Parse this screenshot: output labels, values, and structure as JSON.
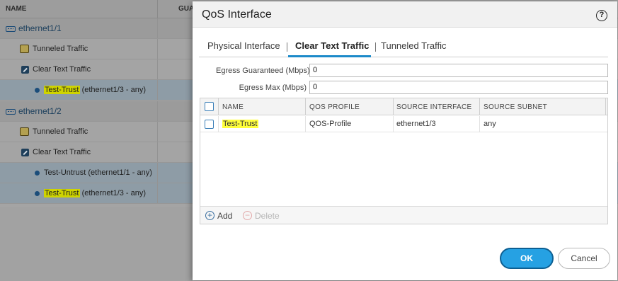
{
  "background_table": {
    "columns": [
      "NAME",
      "GUA"
    ],
    "rows": [
      {
        "label": "ethernet1/1",
        "kind": "interface"
      },
      {
        "label": "Tunneled Traffic",
        "kind": "tunneled"
      },
      {
        "label": "Clear Text Traffic",
        "kind": "clear"
      },
      {
        "label": "Test-Trust",
        "suffix": "(ethernet1/3 - any)",
        "kind": "entry",
        "highlighted": true
      },
      {
        "label": "ethernet1/2",
        "kind": "interface"
      },
      {
        "label": "Tunneled Traffic",
        "kind": "tunneled"
      },
      {
        "label": "Clear Text Traffic",
        "kind": "clear"
      },
      {
        "label": "Test-Untrust",
        "suffix": "(ethernet1/1 - any)",
        "kind": "entry",
        "highlighted": false
      },
      {
        "label": "Test-Trust",
        "suffix": "(ethernet1/3 - any)",
        "kind": "entry",
        "highlighted": true
      }
    ]
  },
  "dialog": {
    "title": "QoS Interface",
    "help_icon": "question-circle-icon",
    "tabs": [
      {
        "label": "Physical Interface",
        "active": false
      },
      {
        "label": "Clear Text Traffic",
        "active": true
      },
      {
        "label": "Tunneled Traffic",
        "active": false
      }
    ],
    "fields": {
      "egress_guaranteed": {
        "label": "Egress Guaranteed (Mbps)",
        "value": "0"
      },
      "egress_max": {
        "label": "Egress Max (Mbps)",
        "value": "0"
      }
    },
    "grid": {
      "headers": [
        "NAME",
        "QOS PROFILE",
        "SOURCE INTERFACE",
        "SOURCE SUBNET"
      ],
      "rows": [
        {
          "name": "Test-Trust",
          "qos_profile": "QOS-Profile",
          "source_interface": "ethernet1/3",
          "source_subnet": "any",
          "checked": false
        }
      ],
      "add_label": "Add",
      "delete_label": "Delete"
    },
    "ok_label": "OK",
    "cancel_label": "Cancel"
  },
  "colors": {
    "accent": "#26a1e3",
    "highlight": "#ffff3a",
    "link": "#1a3e5c"
  }
}
